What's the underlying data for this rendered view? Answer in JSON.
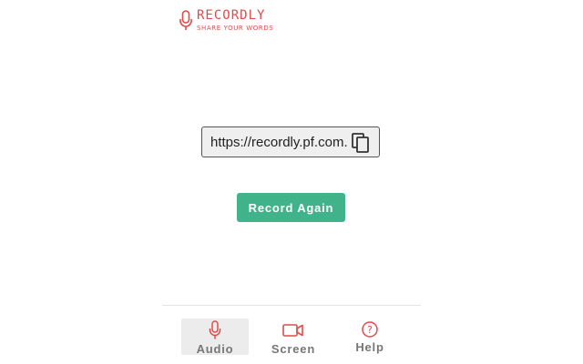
{
  "brand": {
    "name": "RECORDLY",
    "tagline": "SHARE YOUR WORDS",
    "color": "#e34a4a"
  },
  "share": {
    "url": "https://recordly.pf.com.",
    "copy_icon": "copy-icon"
  },
  "actions": {
    "record_again_label": "Record Again",
    "accent": "#41b38b"
  },
  "nav": {
    "items": [
      {
        "label": "Audio",
        "icon": "microphone-icon",
        "active": true
      },
      {
        "label": "Screen",
        "icon": "video-camera-icon",
        "active": false
      },
      {
        "label": "Help",
        "icon": "question-circle-icon",
        "active": false
      }
    ]
  }
}
